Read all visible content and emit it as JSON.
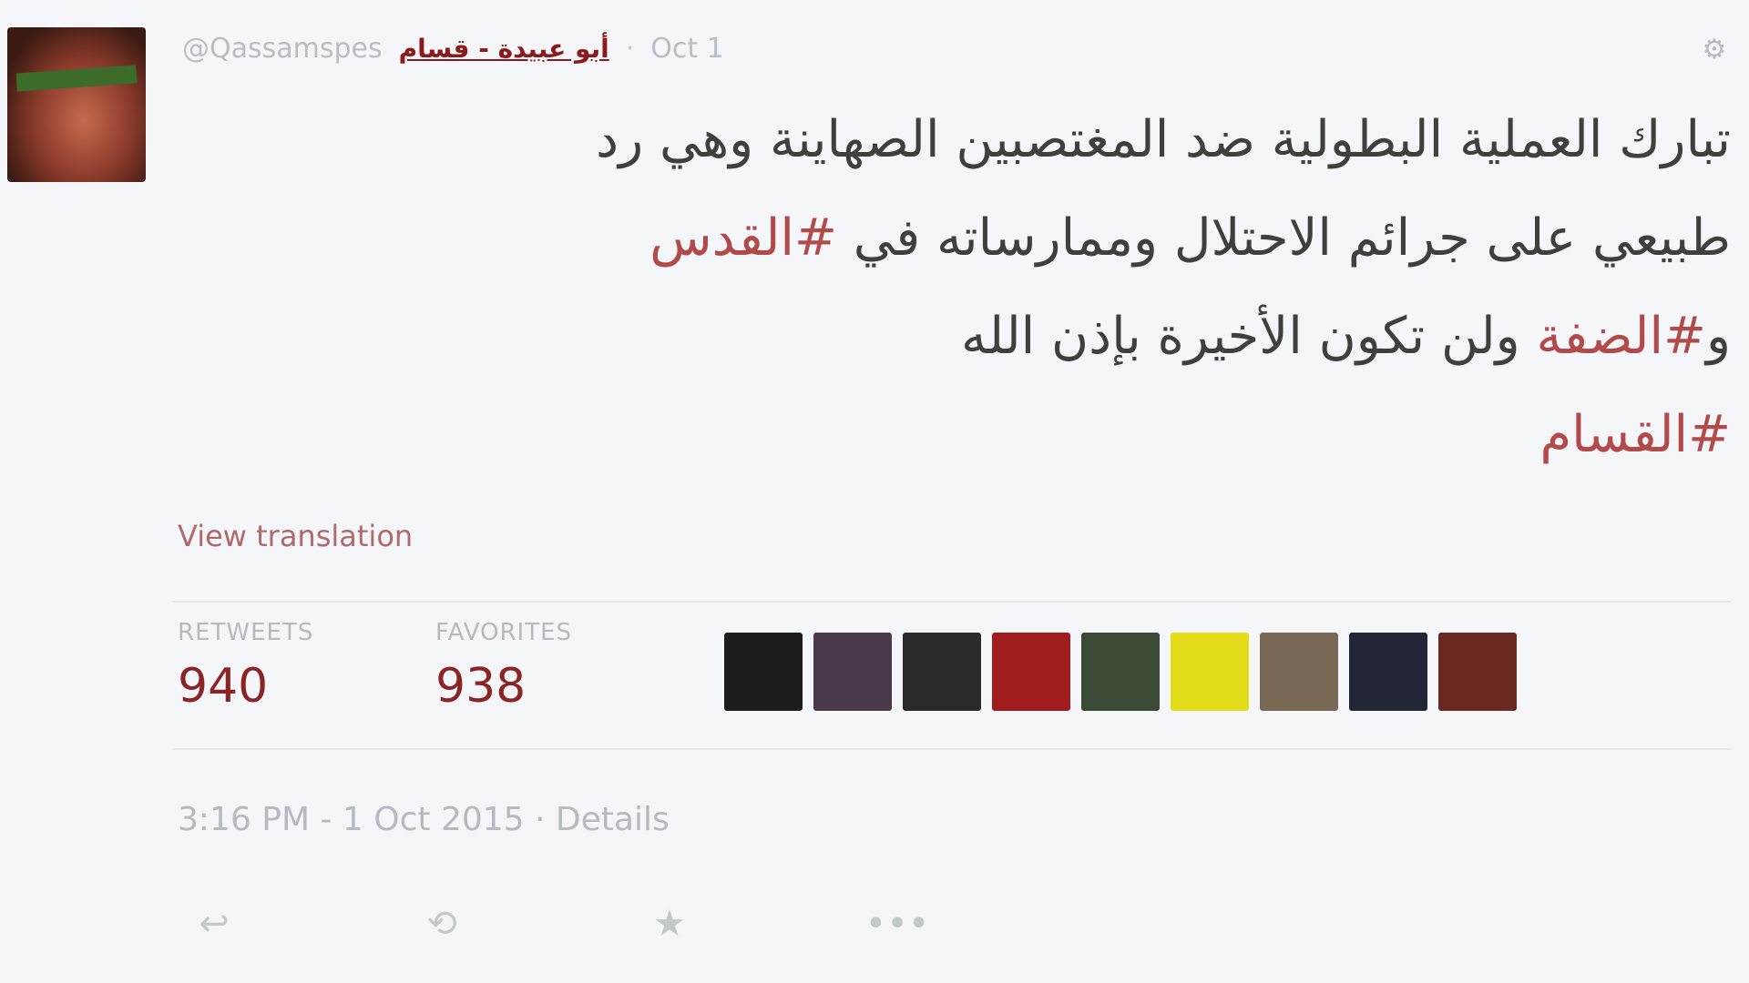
{
  "tweet": {
    "handle": "@Qassamspes",
    "display_name": "أبو عبيدة - قسام",
    "date": "Oct 1",
    "text_line1": "تبارك العملية البطولية ضد المغتصبين الصهاينة وهي رد",
    "text_line2_plain": "طبيعي على جرائم الاحتلال وممارساته في ",
    "text_line2_tag": "#القدس",
    "text_line3_plain": "و",
    "text_line3_tag": "#الضفة",
    "text_line3_rest": " ولن تكون الأخيرة بإذن الله",
    "text_line4_tag": "#القسام",
    "view_translation": "View translation"
  },
  "stats": {
    "retweets_label": "RETWEETS",
    "retweets_value": "940",
    "favorites_label": "FAVORITES",
    "favorites_value": "938"
  },
  "timestamp": "3:16 PM - 1 Oct 2015 · Details",
  "favoriters": [
    {
      "icon": "user-avatar-icon",
      "color": "#1d1d1d"
    },
    {
      "icon": "user-avatar-icon",
      "color": "#4a3a4a"
    },
    {
      "icon": "user-avatar-icon",
      "color": "#2a2a2a"
    },
    {
      "icon": "user-avatar-icon",
      "color": "#a11c1c"
    },
    {
      "icon": "user-avatar-icon",
      "color": "#3b4a34"
    },
    {
      "icon": "user-avatar-icon",
      "color": "#e3dc1b"
    },
    {
      "icon": "user-avatar-icon",
      "color": "#7a6a55"
    },
    {
      "icon": "user-avatar-icon",
      "color": "#222636"
    },
    {
      "icon": "user-avatar-icon",
      "color": "#6a2a22"
    }
  ],
  "actions": {
    "reply_icon": "reply-icon",
    "retweet_icon": "retweet-icon",
    "favorite_icon": "star-icon",
    "more_icon": "more-dots-icon"
  },
  "colors": {
    "accent": "#8b1a1a",
    "hashtag": "#b34a4a",
    "muted": "#b5bac0",
    "background": "#f4f6f9"
  }
}
